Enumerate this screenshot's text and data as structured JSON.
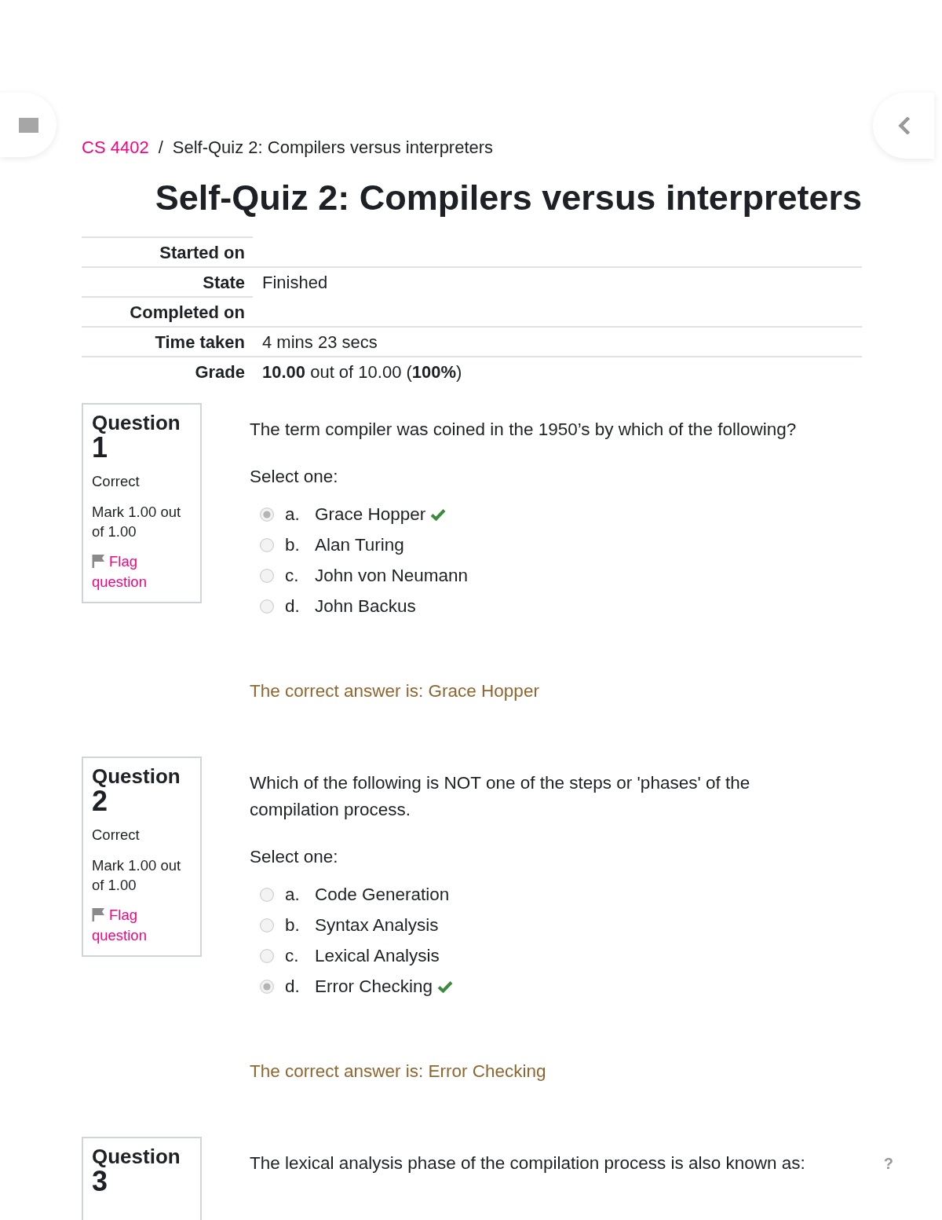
{
  "breadcrumb": {
    "items": [
      {
        "kind": "link",
        "label": "CS 4402"
      },
      {
        "kind": "current",
        "label": "Self-Quiz 2: Compilers versus interpreters"
      }
    ],
    "separator": "/"
  },
  "title": "Self-Quiz 2: Compilers versus interpreters",
  "summary": [
    {
      "label": "Started on"
    },
    {
      "label": "State",
      "value": "Finished"
    },
    {
      "label": "Completed on"
    },
    {
      "label": "Time taken",
      "value": "4 mins 23 secs"
    },
    {
      "label": "Grade",
      "value": "**10.00** out of 10.00 (**100%**)"
    }
  ],
  "questions": [
    {
      "heading": "Question",
      "number": "1",
      "state": "Correct",
      "mark": "Mark 1.00 out of 1.00",
      "flag": "Flag question",
      "text": "The term compiler was coined in the 1950’s by which of the following?",
      "prompt": "Select one:",
      "options": [
        {
          "letter": "a.",
          "label": "Grace Hopper",
          "selected": true,
          "correct": true
        },
        {
          "letter": "b.",
          "label": "Alan Turing",
          "selected": false,
          "correct": false
        },
        {
          "letter": "c.",
          "label": "John von Neumann",
          "selected": false,
          "correct": false
        },
        {
          "letter": "d.",
          "label": "John Backus",
          "selected": false,
          "correct": false
        }
      ],
      "feedback": "The correct answer is: Grace Hopper"
    },
    {
      "heading": "Question",
      "number": "2",
      "state": "Correct",
      "mark": "Mark 1.00 out of 1.00",
      "flag": "Flag question",
      "text": "Which of the following is NOT one of the steps or 'phases' of the compilation process.",
      "prompt": "Select one:",
      "options": [
        {
          "letter": "a.",
          "label": "Code Generation",
          "selected": false,
          "correct": false
        },
        {
          "letter": "b.",
          "label": "Syntax Analysis",
          "selected": false,
          "correct": false
        },
        {
          "letter": "c.",
          "label": "Lexical Analysis",
          "selected": false,
          "correct": false
        },
        {
          "letter": "d.",
          "label": "Error Checking",
          "selected": true,
          "correct": true
        }
      ],
      "feedback": "The correct answer is: Error Checking"
    },
    {
      "heading": "Question",
      "number": "3",
      "text": "The lexical analysis phase of the compilation process is also known as:",
      "help": "?"
    }
  ]
}
